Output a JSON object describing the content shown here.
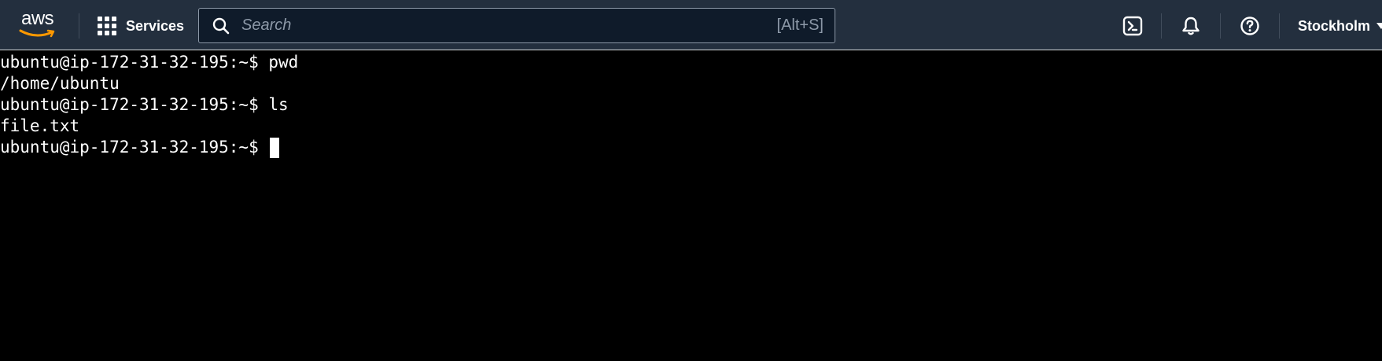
{
  "header": {
    "logo_text": "aws",
    "services_label": "Services",
    "search": {
      "placeholder": "Search",
      "shortcut": "[Alt+S]"
    },
    "icons": [
      "cloudshell-icon",
      "bell-icon",
      "help-icon"
    ],
    "region_label": "Stockholm"
  },
  "colors": {
    "header_bg": "#232f3e",
    "search_bg": "#0f1b2a",
    "terminal_bg": "#000000",
    "terminal_text": "#ffffff",
    "aws_orange": "#ff9900"
  },
  "terminal": {
    "lines": [
      {
        "prompt": "ubuntu@ip-172-31-32-195:~$",
        "command": " pwd"
      },
      {
        "output": "/home/ubuntu"
      },
      {
        "prompt": "ubuntu@ip-172-31-32-195:~$",
        "command": " ls"
      },
      {
        "output": "file.txt"
      },
      {
        "prompt": "ubuntu@ip-172-31-32-195:~$",
        "command": " "
      }
    ]
  }
}
